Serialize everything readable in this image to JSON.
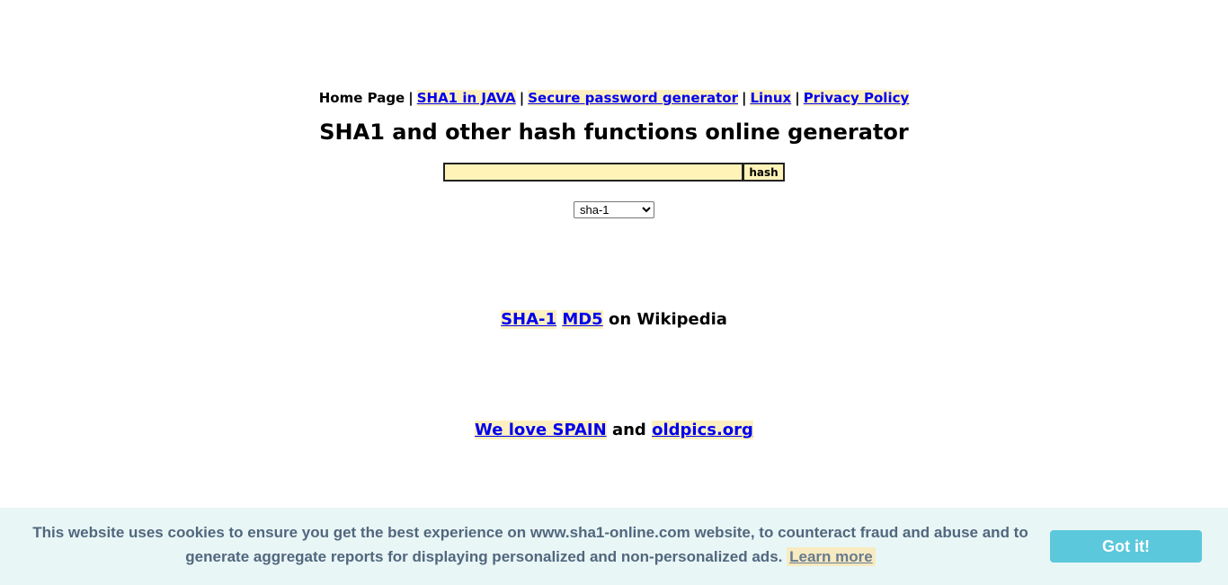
{
  "nav": {
    "home": "Home Page",
    "sep": "|",
    "links": [
      "SHA1 in JAVA",
      "Secure password generator",
      "Linux",
      "Privacy Policy"
    ]
  },
  "title": "SHA1 and other hash functions online generator",
  "form": {
    "input_value": "",
    "button_label": "hash",
    "selected_algorithm": "sha-1"
  },
  "wiki": {
    "link1": "SHA-1",
    "link2": "MD5",
    "suffix": "on Wikipedia"
  },
  "promo": {
    "link1": "We love SPAIN",
    "middle": "and",
    "link2": "oldpics.org"
  },
  "cookie": {
    "text": "This website uses cookies to ensure you get the best experience on www.sha1-online.com website, to counteract fraud and abuse and to generate aggregate reports for displaying personalized and non-personalized ads.",
    "learn_more": "Learn more",
    "accept": "Got it!"
  },
  "colors": {
    "link": "#0000ee",
    "link_highlight": "#fdf0c0",
    "input_bg": "#fff3b8",
    "cookie_bg": "#e9f6f6",
    "cookie_text": "#51677e",
    "accept_button": "#5bc8dc"
  }
}
